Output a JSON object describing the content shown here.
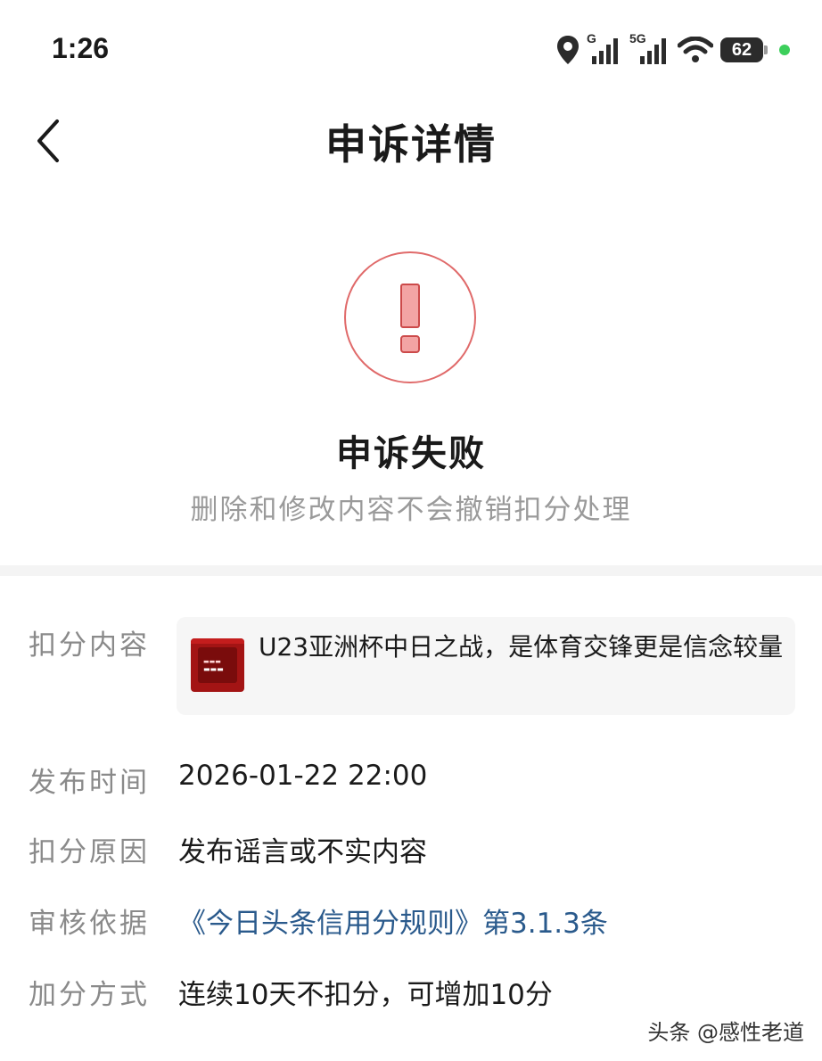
{
  "status_bar": {
    "time": "1:26",
    "network_1": "G",
    "network_2": "5G",
    "battery": "62",
    "charging_color": "#3ccf5b"
  },
  "nav": {
    "back_icon": "chevron-left-icon",
    "title": "申诉详情"
  },
  "result": {
    "icon": "exclamation-circle-icon",
    "status": "申诉失败",
    "message": "删除和修改内容不会撤销扣分处理",
    "accent_color": "#e06a6a"
  },
  "details": {
    "content": {
      "label": "扣分内容",
      "title": "U23亚洲杯中日之战，是体育交锋更是信念较量"
    },
    "publish_time": {
      "label": "发布时间",
      "value": "2026-01-22 22:00"
    },
    "reason": {
      "label": "扣分原因",
      "value": "发布谣言或不实内容"
    },
    "basis": {
      "label": "审核依据",
      "value": "《今日头条信用分规则》第3.1.3条",
      "link_color": "#2a5a8c"
    },
    "recovery": {
      "label": "加分方式",
      "value": "连续10天不扣分，可增加10分"
    }
  },
  "watermark": "头条 @感性老道"
}
